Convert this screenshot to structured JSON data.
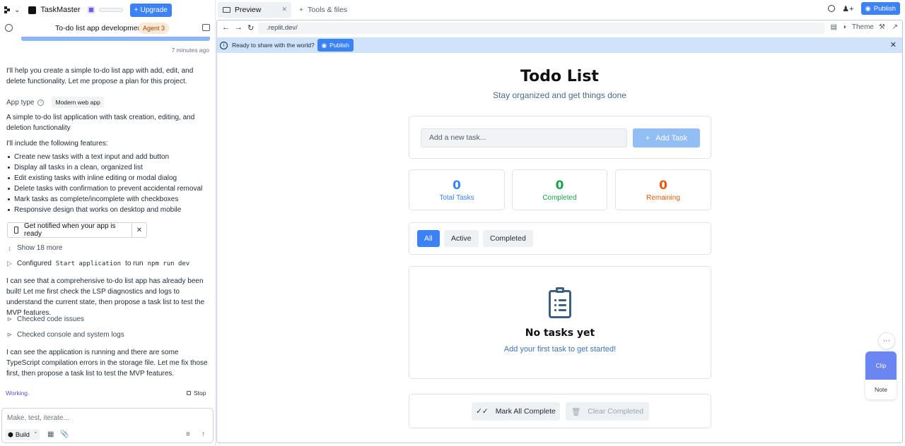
{
  "workspace": {
    "name": "TaskMaster",
    "upgrade_label": "Upgrade"
  },
  "chat": {
    "title": "To-do list app development",
    "agent_badge": "Agent 3",
    "time_ago": "7 minutes ago",
    "intro": "I'll help you create a simple to-do list app with add, edit, and delete functionality. Let me propose a plan for this project.",
    "app_type_label": "App type",
    "app_type_value": "Modern web app",
    "summary": "A simple to-do list application with task creation, editing, and deletion functionality",
    "features_intro": "I'll include the following features:",
    "features": [
      "Create new tasks with a text input and add button",
      "Display all tasks in a clean, organized list",
      "Edit existing tasks with inline editing or modal dialog",
      "Delete tasks with confirmation to prevent accidental removal",
      "Mark tasks as complete/incomplete with checkboxes",
      "Responsive design that works on desktop and mobile"
    ],
    "notify_label": "Get notified when your app is ready",
    "show_more": "Show 18 more",
    "configured_prefix": "Configured",
    "configured_cmd1": "Start application",
    "configured_mid": "to run",
    "configured_cmd2": "npm run dev",
    "msg2": "I can see that a comprehensive to-do list app has already been built! Let me first check the LSP diagnostics and logs to understand the current state, then propose a task list to test the MVP features.",
    "checked_code": "Checked code issues",
    "checked_logs": "Checked console and system logs",
    "msg3": "I can see the application is running and there are some TypeScript compilation errors in the storage file. Let me fix those first, then propose a task list to test the MVP features.",
    "status": "Working.",
    "stop_label": "Stop",
    "composer_placeholder": "Make, test, iterate...",
    "build_label": "Build"
  },
  "tabs": {
    "preview": "Preview",
    "tools": "Tools & files",
    "publish": "Publish"
  },
  "browser": {
    "url": ".replit.dev/",
    "theme_label": "Theme",
    "banner_text": "Ready to share with the world?",
    "banner_publish": "Publish"
  },
  "todo": {
    "title": "Todo List",
    "subtitle": "Stay organized and get things done",
    "input_placeholder": "Add a new task...",
    "add_button": "Add Task",
    "stats": [
      {
        "value": "0",
        "label": "Total Tasks",
        "color": "#3b82f6"
      },
      {
        "value": "0",
        "label": "Completed",
        "color": "#16a34a"
      },
      {
        "value": "0",
        "label": "Remaining",
        "color": "#ea580c"
      }
    ],
    "filters": [
      "All",
      "Active",
      "Completed"
    ],
    "active_filter": "All",
    "empty_title": "No tasks yet",
    "empty_sub": "Add your first task to get started!",
    "mark_all": "Mark All Complete",
    "clear_completed": "Clear Completed"
  },
  "floating": {
    "clip": "Clip",
    "note": "Note"
  }
}
